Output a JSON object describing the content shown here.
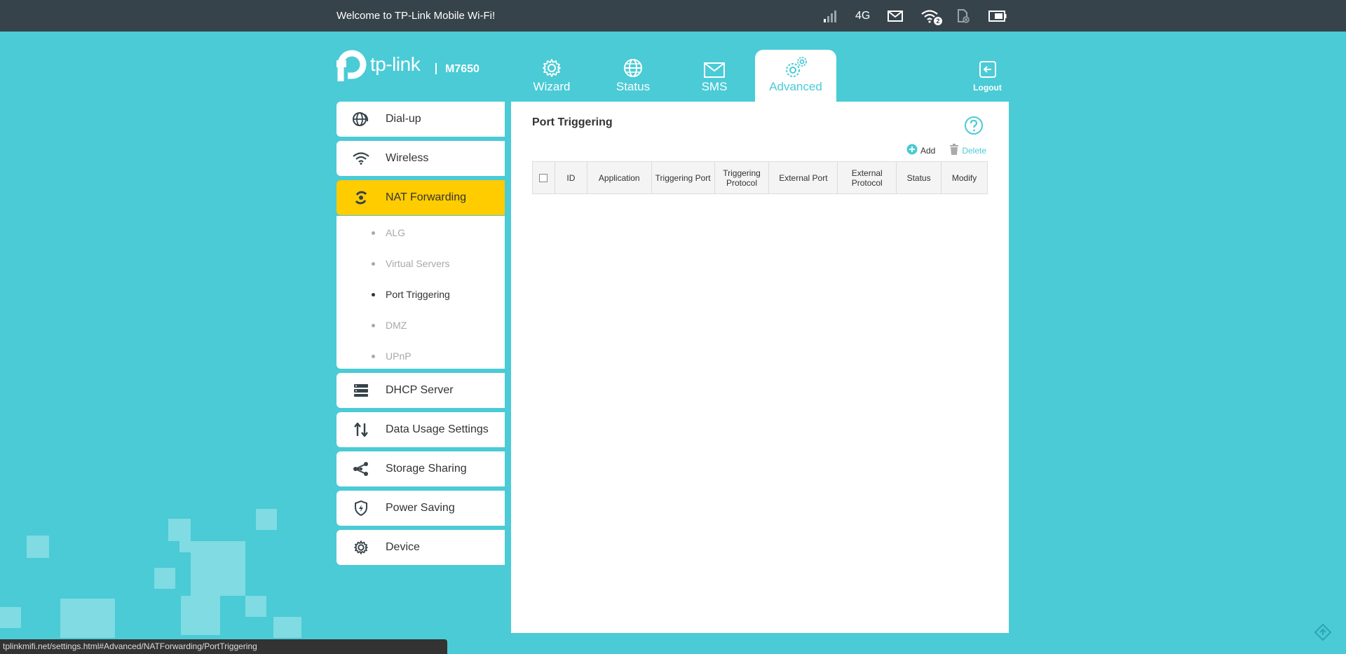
{
  "topbar": {
    "welcome": "Welcome to TP-Link Mobile Wi-Fi!",
    "network_type": "4G",
    "wifi_clients": "2",
    "icons": [
      "signal-icon",
      "mail-icon",
      "wifi-icon",
      "sim-icon",
      "battery-icon"
    ]
  },
  "header": {
    "brand": "tp-link",
    "model": "M7650",
    "tabs": [
      {
        "label": "Wizard",
        "icon": "gear-icon"
      },
      {
        "label": "Status",
        "icon": "globe-icon"
      },
      {
        "label": "SMS",
        "icon": "mail-icon"
      },
      {
        "label": "Advanced",
        "icon": "gears-icon"
      }
    ],
    "logout": "Logout"
  },
  "sidebar": {
    "items": [
      {
        "label": "Dial-up",
        "icon": "globe-phone-icon"
      },
      {
        "label": "Wireless",
        "icon": "wifi-icon"
      },
      {
        "label": "NAT Forwarding",
        "icon": "nat-icon"
      },
      {
        "label": "DHCP Server",
        "icon": "server-icon"
      },
      {
        "label": "Data Usage Settings",
        "icon": "arrows-updown-icon"
      },
      {
        "label": "Storage Sharing",
        "icon": "share-icon"
      },
      {
        "label": "Power Saving",
        "icon": "shield-icon"
      },
      {
        "label": "Device",
        "icon": "gear-icon"
      }
    ],
    "submenu": [
      "ALG",
      "Virtual Servers",
      "Port Triggering",
      "DMZ",
      "UPnP"
    ]
  },
  "content": {
    "title": "Port Triggering",
    "add_label": "Add",
    "delete_label": "Delete",
    "columns": [
      "ID",
      "Application",
      "Triggering Port",
      "Triggering Protocol",
      "External Port",
      "External Protocol",
      "Status",
      "Modify"
    ]
  },
  "status_url": "tplinkmifi.net/settings.html#Advanced/NATForwarding/PortTriggering",
  "colors": {
    "background": "#4acbd6",
    "topbar": "#37434b",
    "active_menu": "#ffcc00",
    "accent": "#4acbd6"
  }
}
